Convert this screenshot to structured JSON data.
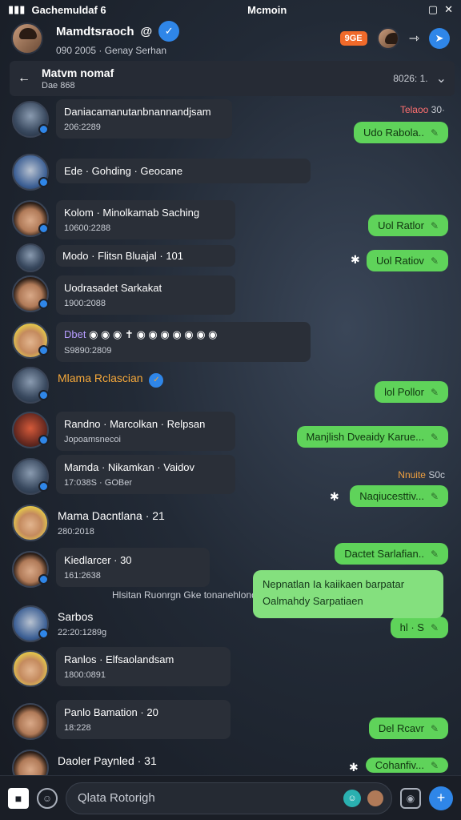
{
  "status": {
    "left": "Gachemuldaf 6",
    "center": "Mcmoin"
  },
  "header": {
    "title": "Mamdtsraoch",
    "subtitle": "090 2005 · Genay Serhan",
    "badge": "9GE"
  },
  "subheader": {
    "title": "Matvm nomaf",
    "caption": "Dae 868",
    "right": "8026: 1."
  },
  "messages": [
    {
      "line1": "Daniacamanutanbnannandjsam",
      "line2": "206:2289"
    },
    {
      "line1": "Ede · Gohding · Geocane"
    },
    {
      "line1": "Kolom · Minolkamab Saching",
      "line2": "10600:2288"
    },
    {
      "line1": "Modo · Flitsn Bluajal · 101"
    },
    {
      "line1": "Uodrasadet Sarkakat",
      "line2": "1900:2088"
    },
    {
      "line1": "Dbet",
      "line2": "S9890:2809"
    },
    {
      "line1": "Mlama Rclascian"
    },
    {
      "line1": "Randno · Marcolkan · Relpsan",
      "line2": "Jopoamsnecoi"
    },
    {
      "line1": "Mamda · Nikamkan · Vaidov",
      "line2": "17:038S · GOBer"
    },
    {
      "line1": "Mama Dacntlana · 21",
      "line2": "280:2018"
    },
    {
      "line1": "Kiedlarcer · 30",
      "line2": "161:2638"
    },
    {
      "line1": "Sarbos",
      "line2": "22:20:1289g"
    },
    {
      "line1": "Ranlos · Elfsaolandsam",
      "line2": "1800:0891"
    },
    {
      "line1": "Panlo Bamation · 20",
      "line2": "18:228"
    },
    {
      "line1": "Daoler Paynled · 31"
    }
  ],
  "outgoing": [
    "Udo Rabola..",
    "Uol Ratlor",
    "Uol Ratiov",
    "lol Pollor",
    "Manjlish Dveaidy Karue...",
    "Naqiucesttiv...",
    "Dactet Sarlafian..",
    "hl · S",
    "Del Rcavr",
    "Cohanfiv..."
  ],
  "big_bubble": {
    "line1": "Nepnatlan Ia kaiikaen barpatar",
    "line2": "Oalmahdy Sarpatiaen"
  },
  "time_tags": {
    "t1_red": "Telaoo",
    "t1_rest": "30·",
    "t2_orange": "Nnuite",
    "t2_rest": "S0c"
  },
  "system_note": "Hlsitan Ruonrgn Gke tonanehlonder...",
  "compose": {
    "placeholder": "Qlata Rotorigh"
  }
}
